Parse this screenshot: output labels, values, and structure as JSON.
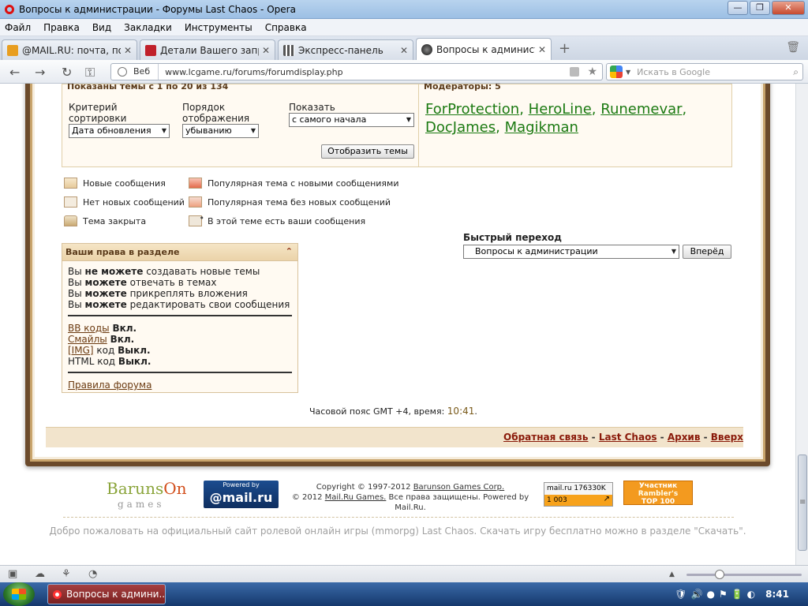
{
  "window": {
    "title": "Вопросы к администрации - Форумы Last Chaos - Opera",
    "minimize": "—",
    "maximize": "❐",
    "close": "✕"
  },
  "menu": [
    "Файл",
    "Правка",
    "Вид",
    "Закладки",
    "Инструменты",
    "Справка"
  ],
  "tabs": [
    {
      "label": "@MAIL.RU: почта, пои...",
      "color": "#e89e20"
    },
    {
      "label": "Детали Вашего запрос...",
      "color": "#c0202a"
    },
    {
      "label": "Экспресс-панель",
      "color": "#555555"
    },
    {
      "label": "Вопросы к админист...",
      "color": "#222222"
    }
  ],
  "tab_close": "✕",
  "new_tab": "+",
  "trash_icon": "🗑",
  "address": {
    "mode": "Веб",
    "url": "www.lcgame.ru/forums/forumdisplay.php",
    "search_placeholder": "Искать в Google"
  },
  "nav_icons": {
    "back": "←",
    "forward": "→",
    "reload": "↻",
    "key": "⚿",
    "star": "★",
    "search": "⌕"
  },
  "forum": {
    "shown_topics": "Показаны темы с 1 по 20 из 134",
    "moderators_title": "Модераторы: 5",
    "sort_label": "Критерий сортировки",
    "sort_value": "Дата обновления",
    "order_label": "Порядок отображения",
    "order_value": "убыванию",
    "show_label": "Показать",
    "show_value": "с самого начала",
    "show_button": "Отобразить темы",
    "moderators": [
      "ForProtection",
      "HeroLine",
      "Runemevar",
      "DocJames",
      "Magikman"
    ],
    "legend": {
      "new": "Новые сообщения",
      "hot_new": "Популярная тема с новыми сообщениями",
      "no_new": "Нет новых сообщений",
      "hot_no_new": "Популярная тема без новых сообщений",
      "closed": "Тема закрыта",
      "yours": "В этой теме есть ваши сообщения"
    },
    "rights": {
      "title": "Ваши права в разделе",
      "collapse": "⌃",
      "lines": [
        {
          "pre": "Вы ",
          "bold": "не можете",
          "post": " создавать новые темы"
        },
        {
          "pre": "Вы ",
          "bold": "можете",
          "post": " отвечать в темах"
        },
        {
          "pre": "Вы ",
          "bold": "можете",
          "post": " прикреплять вложения"
        },
        {
          "pre": "Вы ",
          "bold": "можете",
          "post": " редактировать свои сообщения"
        }
      ],
      "bb_link": "BB коды",
      "bb_state": "Вкл.",
      "smile_link": "Смайлы",
      "smile_state": "Вкл.",
      "img_link": "[IMG]",
      "img_text": " код ",
      "img_state": "Выкл.",
      "html_text": "HTML код ",
      "html_state": "Выкл.",
      "rules_link": "Правила форума"
    },
    "quick_jump": {
      "title": "Быстрый переход",
      "value": "Вопросы к администрации",
      "button": "Вперёд"
    },
    "timezone_text": "Часовой пояс GMT +4, время: ",
    "timezone_time": "10:41",
    "timezone_dot": ".",
    "bottom_links": [
      "Обратная связь",
      "Last Chaos",
      "Архив",
      "Вверх"
    ],
    "bottom_sep": " - "
  },
  "footer": {
    "baruns_a": "Baruns",
    "baruns_b": "On",
    "baruns_sub": "games",
    "mail_powered": "Powered by",
    "mail_brand": "@mail.ru",
    "copyright1_pre": "Copyright © 1997-2012 ",
    "copyright1_link": "Barunson Games Corp.",
    "copyright2_pre": "© 2012 ",
    "copyright2_link": "Mail.Ru Games.",
    "copyright2_post": " Все права защищены. Powered by Mail.Ru.",
    "counter_top": "mail.ru  176330K",
    "counter_bot": "1 003",
    "rambler_lines": [
      "Участник",
      "Rambler's",
      "TOP 100"
    ],
    "welcome": "Добро пожаловать на официальный сайт ролевой онлайн игры (mmorpg) Last Chaos. Скачать игру бесплатно можно в разделе \"Скачать\"."
  },
  "statusbar_icons": [
    "▣",
    "☁",
    "⚘",
    "◔"
  ],
  "statusbar_up": "▲",
  "taskbar": {
    "task_label": "Вопросы к админи...",
    "tray_icons": [
      "🛡",
      "🔊",
      "●",
      "⚑",
      "🔋",
      "◐"
    ],
    "clock": "8:41"
  }
}
